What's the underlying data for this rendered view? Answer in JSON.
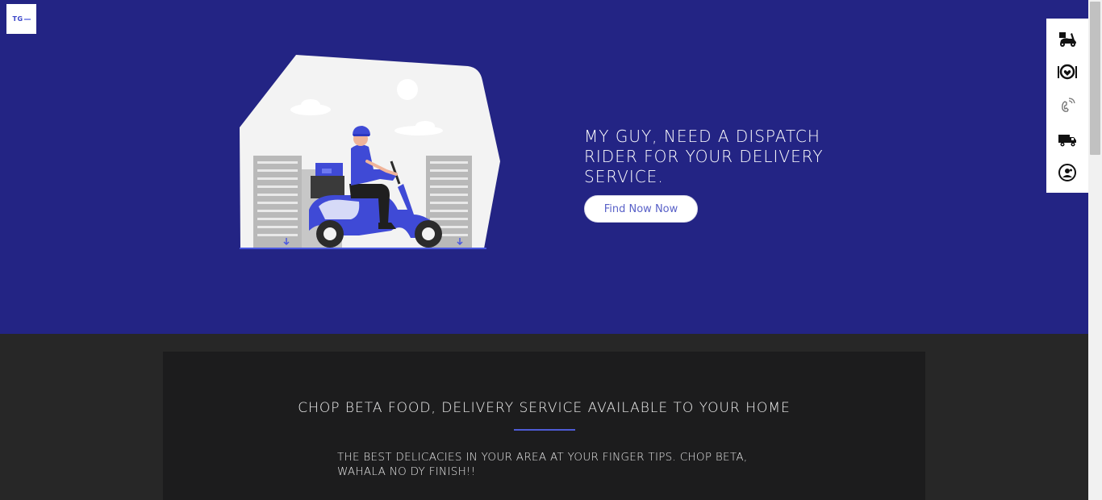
{
  "logo": {
    "text": "TG"
  },
  "hero": {
    "title": "MY GUY, NEED A DISPATCH RIDER FOR YOUR DELIVERY SERVICE.",
    "button_label": "Find Now Now",
    "background": "#232484"
  },
  "side_nav": {
    "items": [
      {
        "icon": "delivery-scooter-icon"
      },
      {
        "icon": "food-plate-icon"
      },
      {
        "icon": "phone-icon"
      },
      {
        "icon": "truck-icon"
      },
      {
        "icon": "user-profile-icon"
      }
    ]
  },
  "section": {
    "title": "CHOP BETA FOOD, DELIVERY SERVICE AVAILABLE TO YOUR HOME",
    "text": "THE BEST DELICACIES IN YOUR AREA AT YOUR FINGER TIPS. CHOP BETA, WAHALA NO DY FINISH!!",
    "accent": "#4e5bd6"
  }
}
